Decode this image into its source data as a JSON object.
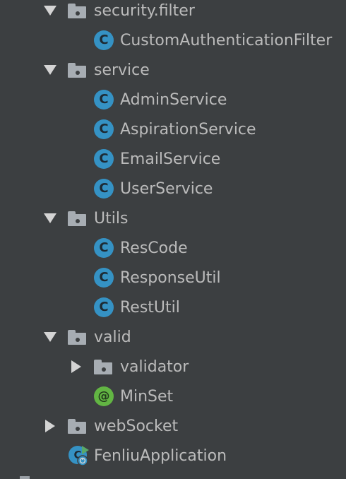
{
  "tree": [
    {
      "label": "security.filter",
      "type": "folder",
      "expanded": true
    },
    {
      "label": "CustomAuthenticationFilter",
      "type": "class"
    },
    {
      "label": "service",
      "type": "folder",
      "expanded": true
    },
    {
      "label": "AdminService",
      "type": "class"
    },
    {
      "label": "AspirationService",
      "type": "class"
    },
    {
      "label": "EmailService",
      "type": "class"
    },
    {
      "label": "UserService",
      "type": "class"
    },
    {
      "label": "Utils",
      "type": "folder",
      "expanded": true
    },
    {
      "label": "ResCode",
      "type": "class"
    },
    {
      "label": "ResponseUtil",
      "type": "class"
    },
    {
      "label": "RestUtil",
      "type": "class"
    },
    {
      "label": "valid",
      "type": "folder",
      "expanded": true
    },
    {
      "label": "validator",
      "type": "folder",
      "expanded": false
    },
    {
      "label": "MinSet",
      "type": "annotation"
    },
    {
      "label": "webSocket",
      "type": "folder",
      "expanded": false
    },
    {
      "label": "FenliuApplication",
      "type": "spring-application"
    }
  ],
  "icons": {
    "class_glyph": "C",
    "annotation_glyph": "@"
  },
  "colors": {
    "background": "#3c3f41",
    "text": "#bbbbbb",
    "class_icon": "#3592c4",
    "annotation_icon": "#62b543",
    "folder_icon": "#a7adb3"
  }
}
